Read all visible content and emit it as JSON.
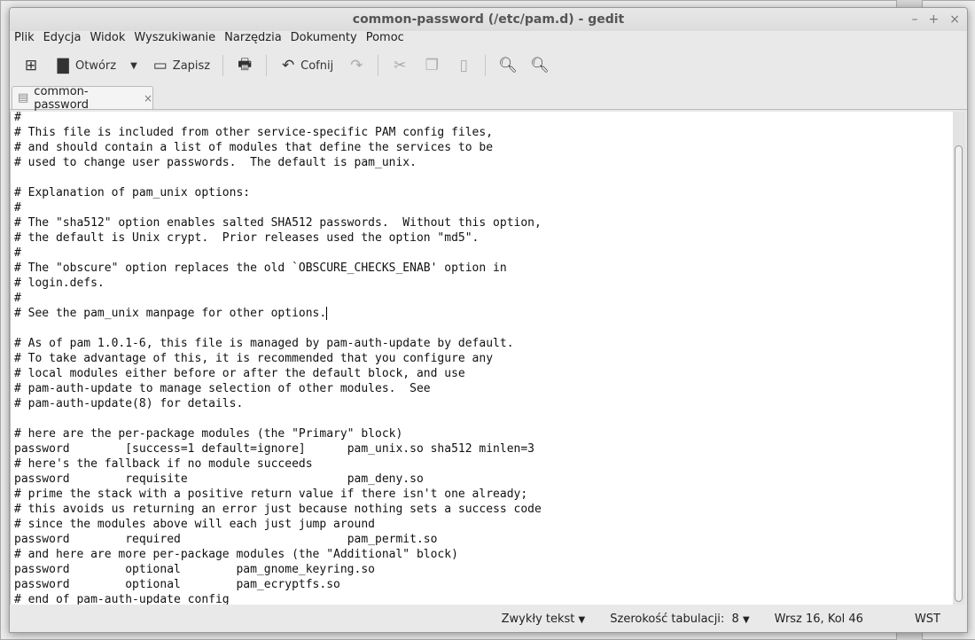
{
  "window": {
    "title": "common-password (/etc/pam.d) - gedit",
    "controls": [
      "–",
      "+",
      "×"
    ]
  },
  "menu": [
    "Plik",
    "Edycja",
    "Widok",
    "Wyszukiwanie",
    "Narzędzia",
    "Dokumenty",
    "Pomoc"
  ],
  "toolbar": {
    "open": "Otwórz",
    "save": "Zapisz",
    "undo": "Cofnij"
  },
  "tab": {
    "label": "common-password",
    "close": "×"
  },
  "lines": [
    "#",
    "# This file is included from other service-specific PAM config files,",
    "# and should contain a list of modules that define the services to be",
    "# used to change user passwords.  The default is pam_unix.",
    "",
    "# Explanation of pam_unix options:",
    "#",
    "# The \"sha512\" option enables salted SHA512 passwords.  Without this option,",
    "# the default is Unix crypt.  Prior releases used the option \"md5\".",
    "#",
    "# The \"obscure\" option replaces the old `OBSCURE_CHECKS_ENAB' option in",
    "# login.defs.",
    "#",
    "# See the pam_unix manpage for other options.",
    "",
    "# As of pam 1.0.1-6, this file is managed by pam-auth-update by default.",
    "# To take advantage of this, it is recommended that you configure any",
    "# local modules either before or after the default block, and use",
    "# pam-auth-update to manage selection of other modules.  See",
    "# pam-auth-update(8) for details.",
    "",
    "# here are the per-package modules (the \"Primary\" block)",
    "password\t[success=1 default=ignore]\tpam_unix.so sha512 minlen=3",
    "# here's the fallback if no module succeeds",
    "password\trequisite\t\t\tpam_deny.so",
    "# prime the stack with a positive return value if there isn't one already;",
    "# this avoids us returning an error just because nothing sets a success code",
    "# since the modules above will each just jump around",
    "password\trequired\t\t\tpam_permit.so",
    "# and here are more per-package modules (the \"Additional\" block)",
    "password\toptional\tpam_gnome_keyring.so",
    "password\toptional\tpam_ecryptfs.so",
    "# end of pam-auth-update config"
  ],
  "status": {
    "language": "Zwykły tekst",
    "tab_width": "Szerokość tabulacji:  8",
    "position": "Wrsz 16, Kol 46",
    "mode": "WST"
  }
}
